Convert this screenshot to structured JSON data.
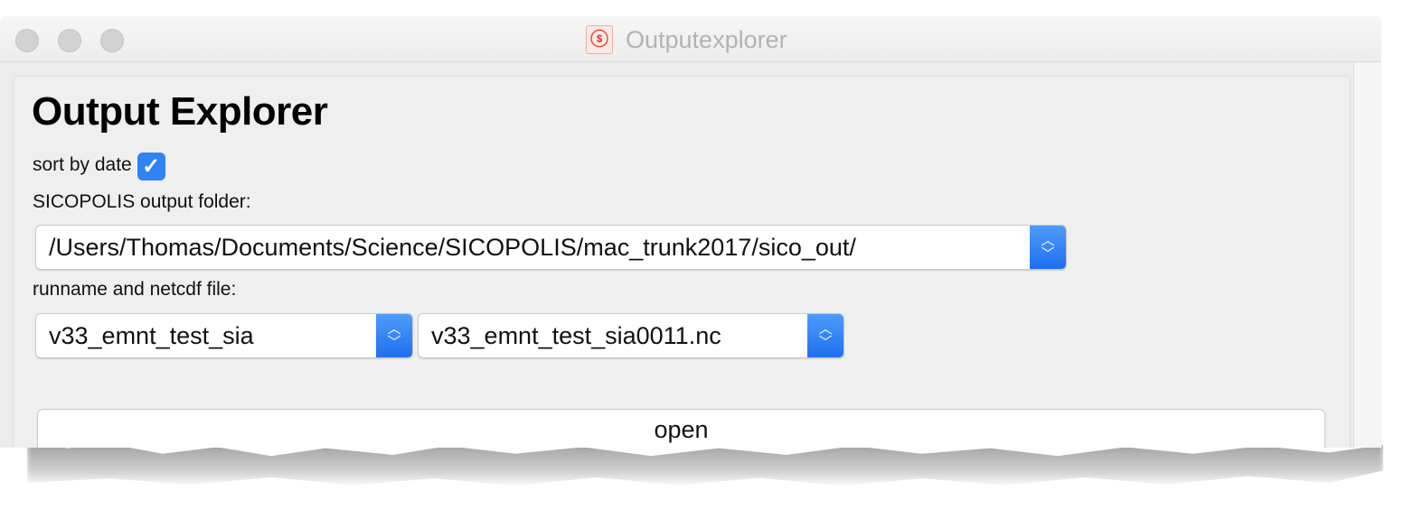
{
  "window": {
    "title": "Outputexplorer"
  },
  "app": {
    "heading": "Output Explorer",
    "sort_by_date_label": "sort by date",
    "sort_by_date_checked": true,
    "folder_label": "SICOPOLIS output folder:",
    "folder_value": "/Users/Thomas/Documents/Science/SICOPOLIS/mac_trunk2017/sico_out/",
    "run_label": "runname and netcdf file:",
    "runname_value": "v33_emnt_test_sia",
    "netcdf_value": "v33_emnt_test_sia0011.nc",
    "open_label": "open"
  },
  "icons": {
    "app_icon": "sicopolis-app-icon",
    "checkmark": "checkmark-icon",
    "stepper": "chevron-up-down-icon"
  },
  "colors": {
    "accent": "#2f83f5",
    "traffic_light_inactive": "#d2d2d2",
    "title_text": "#b3b3b3"
  }
}
